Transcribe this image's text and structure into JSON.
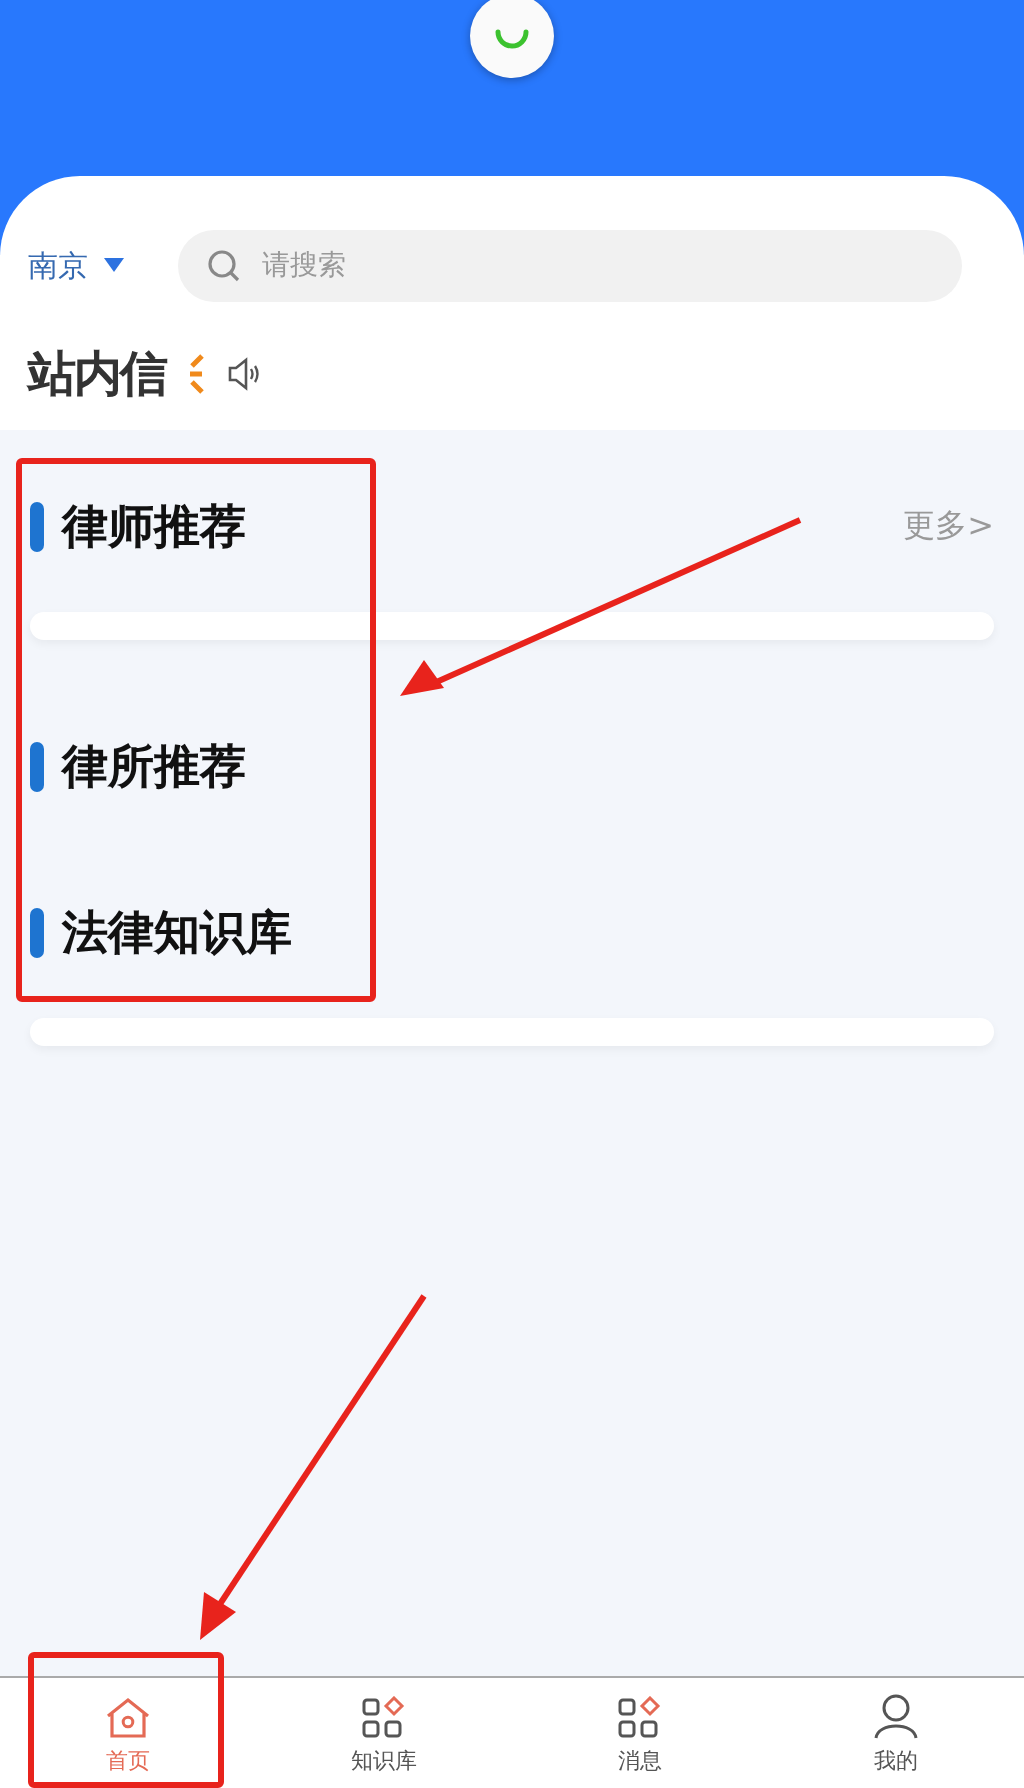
{
  "location": {
    "city": "南京"
  },
  "search": {
    "placeholder": "请搜索"
  },
  "notice": {
    "logo": "站内信"
  },
  "sections": [
    {
      "title": "律师推荐",
      "more": "更多>",
      "card": true
    },
    {
      "title": "律所推荐",
      "card": false
    },
    {
      "title": "法律知识库",
      "card": true
    }
  ],
  "tabs": [
    {
      "label": "首页",
      "kind": "home",
      "selected": true
    },
    {
      "label": "知识库",
      "kind": "grid",
      "selected": false
    },
    {
      "label": "消息",
      "kind": "grid",
      "selected": false
    },
    {
      "label": "我的",
      "kind": "user",
      "selected": false
    }
  ]
}
